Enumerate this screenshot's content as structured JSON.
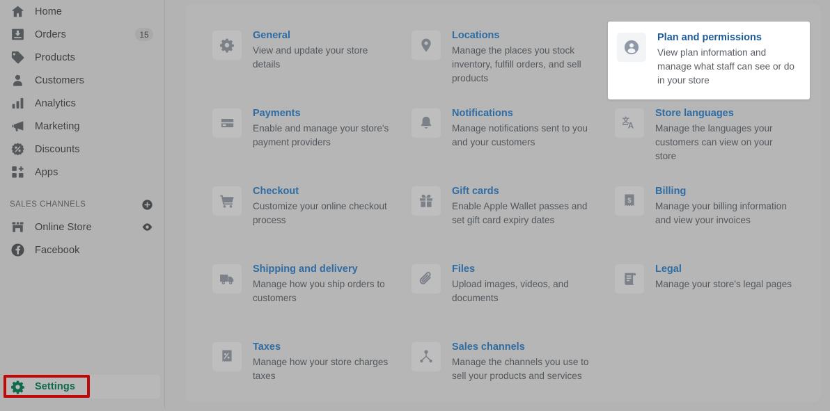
{
  "sidebar": {
    "items": [
      {
        "label": "Home",
        "icon": "home-icon",
        "badge": null,
        "right_icon": null
      },
      {
        "label": "Orders",
        "icon": "orders-icon",
        "badge": "15",
        "right_icon": null
      },
      {
        "label": "Products",
        "icon": "products-icon",
        "badge": null,
        "right_icon": null
      },
      {
        "label": "Customers",
        "icon": "customers-icon",
        "badge": null,
        "right_icon": null
      },
      {
        "label": "Analytics",
        "icon": "analytics-icon",
        "badge": null,
        "right_icon": null
      },
      {
        "label": "Marketing",
        "icon": "marketing-icon",
        "badge": null,
        "right_icon": null
      },
      {
        "label": "Discounts",
        "icon": "discounts-icon",
        "badge": null,
        "right_icon": null
      },
      {
        "label": "Apps",
        "icon": "apps-icon",
        "badge": null,
        "right_icon": null
      }
    ],
    "sales_channels": {
      "header": "SALES CHANNELS",
      "add_icon": "plus-circle-icon",
      "items": [
        {
          "label": "Online Store",
          "icon": "storefront-icon",
          "right_icon": "eye-icon"
        },
        {
          "label": "Facebook",
          "icon": "facebook-icon",
          "right_icon": null
        }
      ]
    },
    "settings": {
      "label": "Settings",
      "icon": "gear-icon",
      "accent_color": "#0f6a4a",
      "highlight_color": "#c10808"
    }
  },
  "main": {
    "cards": [
      {
        "title": "General",
        "description": "View and update your store details",
        "icon": "gear-icon",
        "highlighted": false
      },
      {
        "title": "Locations",
        "description": "Manage the places you stock inventory, fulfill orders, and sell products",
        "icon": "location-pin-icon",
        "highlighted": false
      },
      {
        "title": "Plan and permissions",
        "description": "View plan information and manage what staff can see or do in your store",
        "icon": "person-circle-icon",
        "highlighted": true
      },
      {
        "title": "Payments",
        "description": "Enable and manage your store's payment providers",
        "icon": "credit-card-icon",
        "highlighted": false
      },
      {
        "title": "Notifications",
        "description": "Manage notifications sent to you and your customers",
        "icon": "bell-icon",
        "highlighted": false
      },
      {
        "title": "Store languages",
        "description": "Manage the languages your customers can view on your store",
        "icon": "translate-icon",
        "highlighted": false
      },
      {
        "title": "Checkout",
        "description": "Customize your online checkout process",
        "icon": "shopping-cart-icon",
        "highlighted": false
      },
      {
        "title": "Gift cards",
        "description": "Enable Apple Wallet passes and set gift card expiry dates",
        "icon": "gift-icon",
        "highlighted": false
      },
      {
        "title": "Billing",
        "description": "Manage your billing information and view your invoices",
        "icon": "receipt-dollar-icon",
        "highlighted": false
      },
      {
        "title": "Shipping and delivery",
        "description": "Manage how you ship orders to customers",
        "icon": "truck-icon",
        "highlighted": false
      },
      {
        "title": "Files",
        "description": "Upload images, videos, and documents",
        "icon": "paperclip-icon",
        "highlighted": false
      },
      {
        "title": "Legal",
        "description": "Manage your store's legal pages",
        "icon": "scroll-document-icon",
        "highlighted": false
      },
      {
        "title": "Taxes",
        "description": "Manage how your store charges taxes",
        "icon": "receipt-percent-icon",
        "highlighted": false
      },
      {
        "title": "Sales channels",
        "description": "Manage the channels you use to sell your products and services",
        "icon": "channels-node-icon",
        "highlighted": false
      }
    ]
  },
  "theme": {
    "page_background": "#b3b3b3",
    "panel_background": "#b6b6b6",
    "link_color": "#2e6ca3",
    "text_color": "#53585d"
  }
}
